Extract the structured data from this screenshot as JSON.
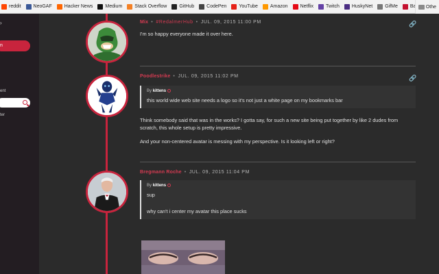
{
  "bookmarks": [
    {
      "label": "reddit",
      "color": "#ff4500"
    },
    {
      "label": "NeoGAF",
      "color": "#3b5998"
    },
    {
      "label": "Hacker News",
      "color": "#ff6600"
    },
    {
      "label": "Medium",
      "color": "#111111"
    },
    {
      "label": "Stack Overflow",
      "color": "#f48024"
    },
    {
      "label": "GitHub",
      "color": "#222222"
    },
    {
      "label": "CodePen",
      "color": "#444444"
    },
    {
      "label": "YouTube",
      "color": "#e62117"
    },
    {
      "label": "Amazon",
      "color": "#ff9900"
    },
    {
      "label": "Netflix",
      "color": "#e50914"
    },
    {
      "label": "Twitch",
      "color": "#6441a5"
    },
    {
      "label": "HuskyNet",
      "color": "#4b2e83"
    },
    {
      "label": "GifMe",
      "color": "#777777"
    },
    {
      "label": "Bank",
      "color": "#c41230"
    }
  ],
  "bookmarks_other": "Othe",
  "sidebar": {
    "active_label": "n",
    "item_a": "ent",
    "item_b": "ter"
  },
  "posts": [
    {
      "user": "Mix",
      "tag": "#RedalmerHub",
      "date": "JUL. 09, 2015 11:00 PM",
      "paragraphs": [
        "I'm so happy everyone made it over here."
      ]
    },
    {
      "user": "Poodlestrike",
      "date": "JUL. 09, 2015 11:02 PM",
      "quote_by": "kittens",
      "quote_text": [
        "this world wide web site needs a logo so it's not just a white page on my bookmarks bar"
      ],
      "paragraphs": [
        "Think somebody said that was in the works? I gotta say, for such a new site being put together by like 2 dudes from scratch, this whole setup is pretty impressive.",
        "And your non-centered avatar is messing with my perspective. Is it looking left or right?"
      ]
    },
    {
      "user": "Bregmann Roche",
      "date": "JUL. 09, 2015 11:04 PM",
      "quote_by": "kittens",
      "quote_text": [
        "sup",
        "why can't i center my avatar this place sucks"
      ]
    }
  ],
  "labels": {
    "by": "By"
  },
  "colors": {
    "accent": "#c8243d",
    "background": "#2b2b2b",
    "sidebar": "#231d22"
  }
}
